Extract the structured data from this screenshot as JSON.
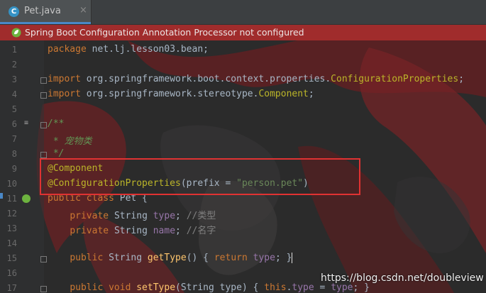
{
  "tab": {
    "label": "Pet.java",
    "icon_letter": "C",
    "close": "×"
  },
  "banner": {
    "message": "Spring Boot Configuration Annotation Processor not configured"
  },
  "lines": [
    {
      "n": "1",
      "tokens": [
        [
          "kw",
          "package "
        ],
        [
          "",
          "net.lj.lesson03.bean;"
        ]
      ]
    },
    {
      "n": "2",
      "tokens": []
    },
    {
      "n": "3",
      "tokens": [
        [
          "kw",
          "import "
        ],
        [
          "",
          "org.springframework.boot.context.properties."
        ],
        [
          "ann",
          "ConfigurationProperties"
        ],
        [
          "",
          ";"
        ]
      ]
    },
    {
      "n": "4",
      "tokens": [
        [
          "kw",
          "import "
        ],
        [
          "",
          "org.springframework.stereotype."
        ],
        [
          "ann",
          "Component"
        ],
        [
          "",
          ";"
        ]
      ]
    },
    {
      "n": "5",
      "tokens": []
    },
    {
      "n": "6",
      "tokens": [
        [
          "cm",
          "/**"
        ]
      ]
    },
    {
      "n": "7",
      "tokens": [
        [
          "cm",
          " * 宠物类"
        ]
      ]
    },
    {
      "n": "8",
      "tokens": [
        [
          "cm",
          " */"
        ]
      ]
    },
    {
      "n": "9",
      "tokens": [
        [
          "ann",
          "@Component"
        ]
      ]
    },
    {
      "n": "10",
      "tokens": [
        [
          "ann",
          "@ConfigurationProperties"
        ],
        [
          "",
          "(prefix = "
        ],
        [
          "str",
          "\"person.pet\""
        ],
        [
          "",
          ")"
        ]
      ]
    },
    {
      "n": "11",
      "tokens": [
        [
          "kw",
          "public class "
        ],
        [
          "",
          "Pet {"
        ]
      ]
    },
    {
      "n": "12",
      "tokens": [
        [
          "",
          "    "
        ],
        [
          "kw",
          "private "
        ],
        [
          "",
          "String "
        ],
        [
          "fld",
          "type"
        ],
        [
          "",
          "; "
        ],
        [
          "lc",
          "//类型"
        ]
      ]
    },
    {
      "n": "13",
      "tokens": [
        [
          "",
          "    "
        ],
        [
          "kw",
          "private "
        ],
        [
          "",
          "String "
        ],
        [
          "fld",
          "name"
        ],
        [
          "",
          "; "
        ],
        [
          "lc",
          "//名字"
        ]
      ]
    },
    {
      "n": "14",
      "tokens": []
    },
    {
      "n": "15",
      "tokens": [
        [
          "",
          "    "
        ],
        [
          "kw",
          "public "
        ],
        [
          "",
          "String "
        ],
        [
          "fn",
          "getType"
        ],
        [
          "",
          "() { "
        ],
        [
          "kw",
          "return "
        ],
        [
          "fld",
          "type"
        ],
        [
          "",
          "; }"
        ]
      ]
    },
    {
      "n": "16",
      "tokens": []
    },
    {
      "n": "17",
      "tokens": [
        [
          "",
          "    "
        ],
        [
          "kw",
          "public void "
        ],
        [
          "fn",
          "setType"
        ],
        [
          "",
          "(String type) { "
        ],
        [
          "kw",
          "this"
        ],
        [
          "",
          "."
        ],
        [
          "fld",
          "type"
        ],
        [
          "",
          " = "
        ],
        [
          "fld",
          "type"
        ],
        [
          "",
          "; }"
        ]
      ]
    }
  ],
  "watermark": "https://blog.csdn.net/doubleview",
  "colors": {
    "banner": "#a02c2c",
    "highlight_box": "#e03232",
    "accent": "#4a88c7"
  }
}
